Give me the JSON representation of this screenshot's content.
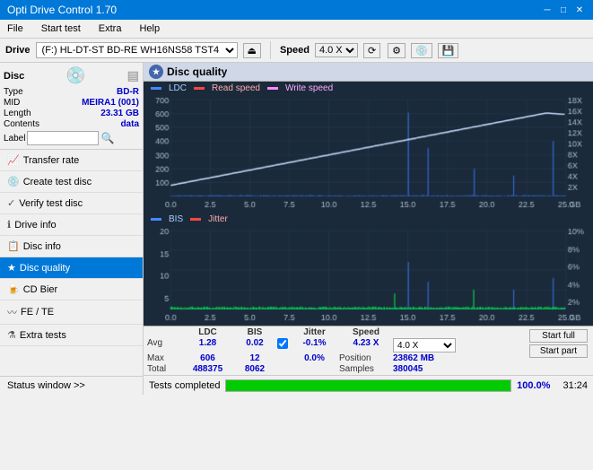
{
  "titlebar": {
    "title": "Opti Drive Control 1.70",
    "min": "─",
    "max": "□",
    "close": "✕"
  },
  "menubar": {
    "items": [
      "File",
      "Start test",
      "Extra",
      "Help"
    ]
  },
  "drivebar": {
    "label": "Drive",
    "drive_value": "(F:)  HL-DT-ST BD-RE  WH16NS58 TST4",
    "speed_label": "Speed",
    "speed_value": "4.0 X"
  },
  "sidebar": {
    "disc_section": "Disc",
    "disc_type_label": "Type",
    "disc_type_value": "BD-R",
    "disc_mid_label": "MID",
    "disc_mid_value": "MEIRA1 (001)",
    "disc_length_label": "Length",
    "disc_length_value": "23.31 GB",
    "disc_contents_label": "Contents",
    "disc_contents_value": "data",
    "disc_label_label": "Label",
    "disc_label_value": "",
    "nav_items": [
      {
        "id": "transfer-rate",
        "label": "Transfer rate",
        "active": false
      },
      {
        "id": "create-test-disc",
        "label": "Create test disc",
        "active": false
      },
      {
        "id": "verify-test-disc",
        "label": "Verify test disc",
        "active": false
      },
      {
        "id": "drive-info",
        "label": "Drive info",
        "active": false
      },
      {
        "id": "disc-info",
        "label": "Disc info",
        "active": false
      },
      {
        "id": "disc-quality",
        "label": "Disc quality",
        "active": true
      },
      {
        "id": "cd-bier",
        "label": "CD Bier",
        "active": false
      },
      {
        "id": "fe-te",
        "label": "FE / TE",
        "active": false
      },
      {
        "id": "extra-tests",
        "label": "Extra tests",
        "active": false
      }
    ],
    "status_window": "Status window >>"
  },
  "disc_quality": {
    "title": "Disc quality",
    "legend": {
      "ldc": "LDC",
      "read_speed": "Read speed",
      "write_speed": "Write speed"
    },
    "legend2": {
      "bis": "BIS",
      "jitter": "Jitter"
    },
    "chart1": {
      "y_max": 700,
      "y_labels": [
        "700",
        "600",
        "500",
        "400",
        "300",
        "200",
        "100"
      ],
      "y_right_labels": [
        "18X",
        "16X",
        "14X",
        "12X",
        "10X",
        "8X",
        "6X",
        "4X",
        "2X"
      ],
      "x_labels": [
        "0.0",
        "2.5",
        "5.0",
        "7.5",
        "10.0",
        "12.5",
        "15.0",
        "17.5",
        "20.0",
        "22.5",
        "25.0"
      ],
      "x_unit": "GB"
    },
    "chart2": {
      "y_labels": [
        "20",
        "15",
        "10",
        "5"
      ],
      "y_right_labels": [
        "10%",
        "8%",
        "6%",
        "4%",
        "2%"
      ],
      "x_labels": [
        "0.0",
        "2.5",
        "5.0",
        "7.5",
        "10.0",
        "12.5",
        "15.0",
        "17.5",
        "20.0",
        "22.5",
        "25.0"
      ],
      "x_unit": "GB"
    }
  },
  "stats": {
    "headers": [
      "",
      "LDC",
      "BIS",
      "",
      "Jitter",
      "Speed",
      ""
    ],
    "avg_label": "Avg",
    "avg_ldc": "1.28",
    "avg_bis": "0.02",
    "avg_jitter": "-0.1%",
    "max_label": "Max",
    "max_ldc": "606",
    "max_bis": "12",
    "max_jitter": "0.0%",
    "total_label": "Total",
    "total_ldc": "488375",
    "total_bis": "8062",
    "speed_label": "Speed",
    "speed_value": "4.23 X",
    "speed_select": "4.0 X",
    "position_label": "Position",
    "position_value": "23862 MB",
    "samples_label": "Samples",
    "samples_value": "380045",
    "jitter_checked": true,
    "start_full": "Start full",
    "start_part": "Start part"
  },
  "statusbar": {
    "text": "Tests completed",
    "progress": 100,
    "time": "31:24"
  }
}
